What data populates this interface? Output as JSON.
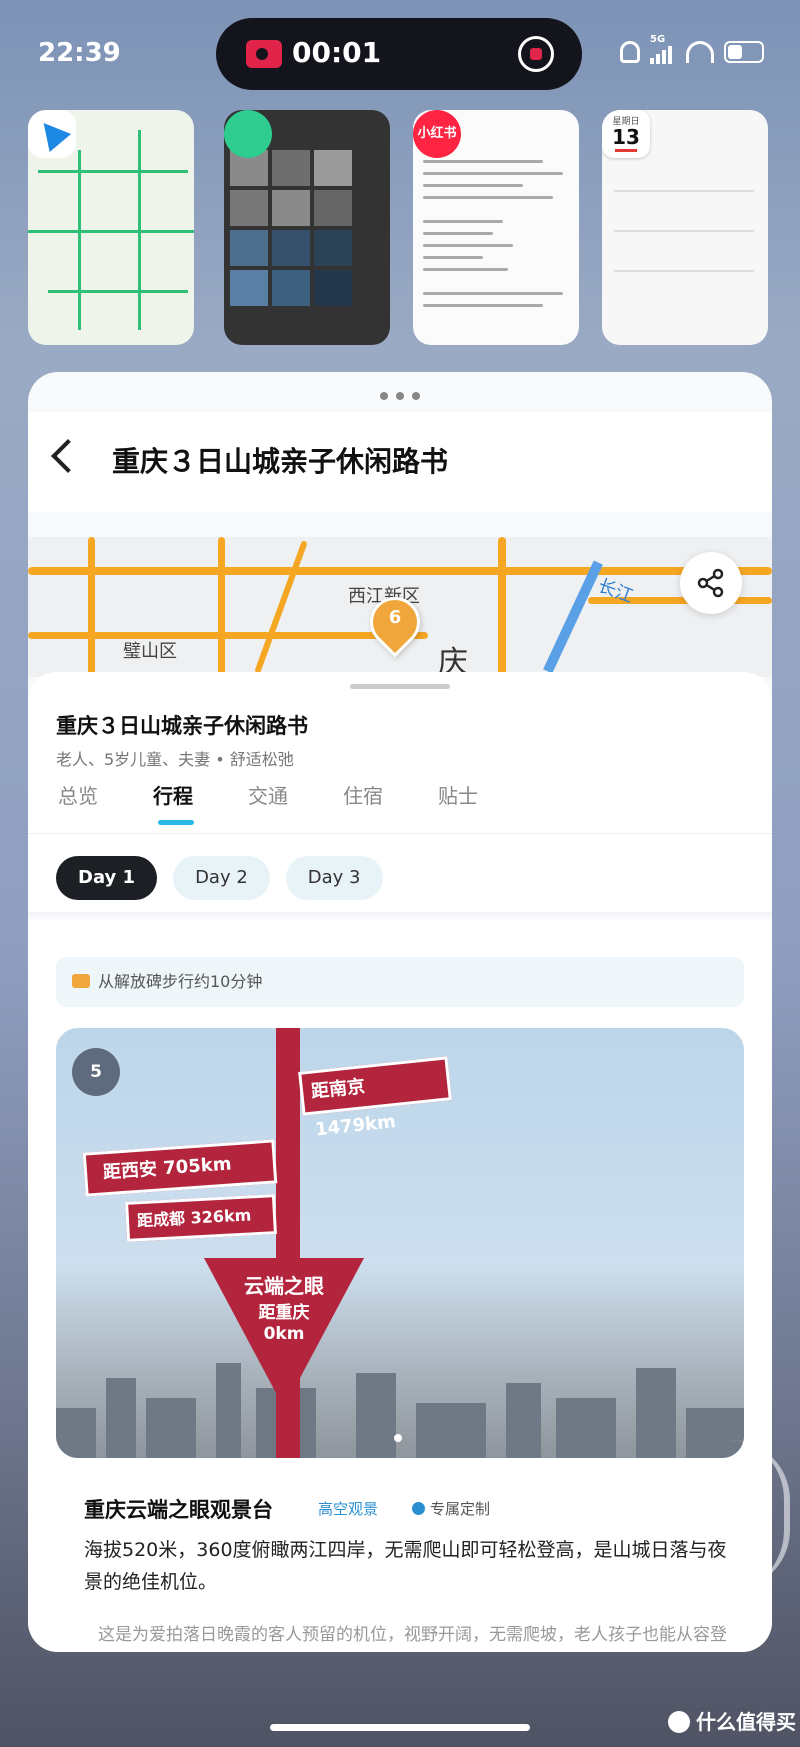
{
  "status_bar": {
    "time": "22:39",
    "recording_time": "00:01",
    "network": "5G"
  },
  "recent_apps": [
    {
      "name": "map",
      "icon": "navigation-icon"
    },
    {
      "name": "gallery",
      "icon": "gallery-icon"
    },
    {
      "name": "xiaohongshu",
      "icon": "xiaohongshu-icon",
      "badge_text": "小红书"
    },
    {
      "name": "calendar",
      "icon": "calendar-icon",
      "weekday": "星期日",
      "day": "13"
    }
  ],
  "header": {
    "title": "重庆３日山城亲子休闲路书"
  },
  "map": {
    "labels": [
      "西江新区",
      "璧山区",
      "长江",
      "庆"
    ],
    "pin_number": "6"
  },
  "guide": {
    "title": "重庆３日山城亲子休闲路书",
    "subtitle": "老人、5岁儿童、夫妻 • 舒适松弛"
  },
  "tabs": [
    {
      "label": "总览",
      "active": false
    },
    {
      "label": "行程",
      "active": true
    },
    {
      "label": "交通",
      "active": false
    },
    {
      "label": "住宿",
      "active": false
    },
    {
      "label": "贴士",
      "active": false
    }
  ],
  "days": [
    {
      "label": "Day 1",
      "active": true
    },
    {
      "label": "Day 2",
      "active": false
    },
    {
      "label": "Day 3",
      "active": false
    }
  ],
  "transport_tip": "从解放碑步行约10分钟",
  "poi": {
    "index": "5",
    "name": "重庆云端之眼观景台",
    "tag": "高空观景",
    "custom_tag": "专属定制",
    "description": "海拔520米，360度俯瞰两江四岸，无需爬山即可轻松登高，是山城日落与夜景的绝佳机位。",
    "more": "这是为爱拍落日晚霞的客人预留的机位，视野开阔，无需爬坡，老人孩子也能从容登",
    "signs": {
      "nanjing": "距南京 1479km",
      "xian": "距西安 705km",
      "chengdu": "距成都 326km",
      "eye_line1": "云端之眼",
      "eye_line2": "距重庆",
      "eye_line3": "0km"
    }
  },
  "watermark": "什么值得买",
  "colors": {
    "accent": "#29b6e8",
    "pin": "#f0a63a",
    "record": "#e0244a",
    "dark_chip": "#1c1f24"
  }
}
